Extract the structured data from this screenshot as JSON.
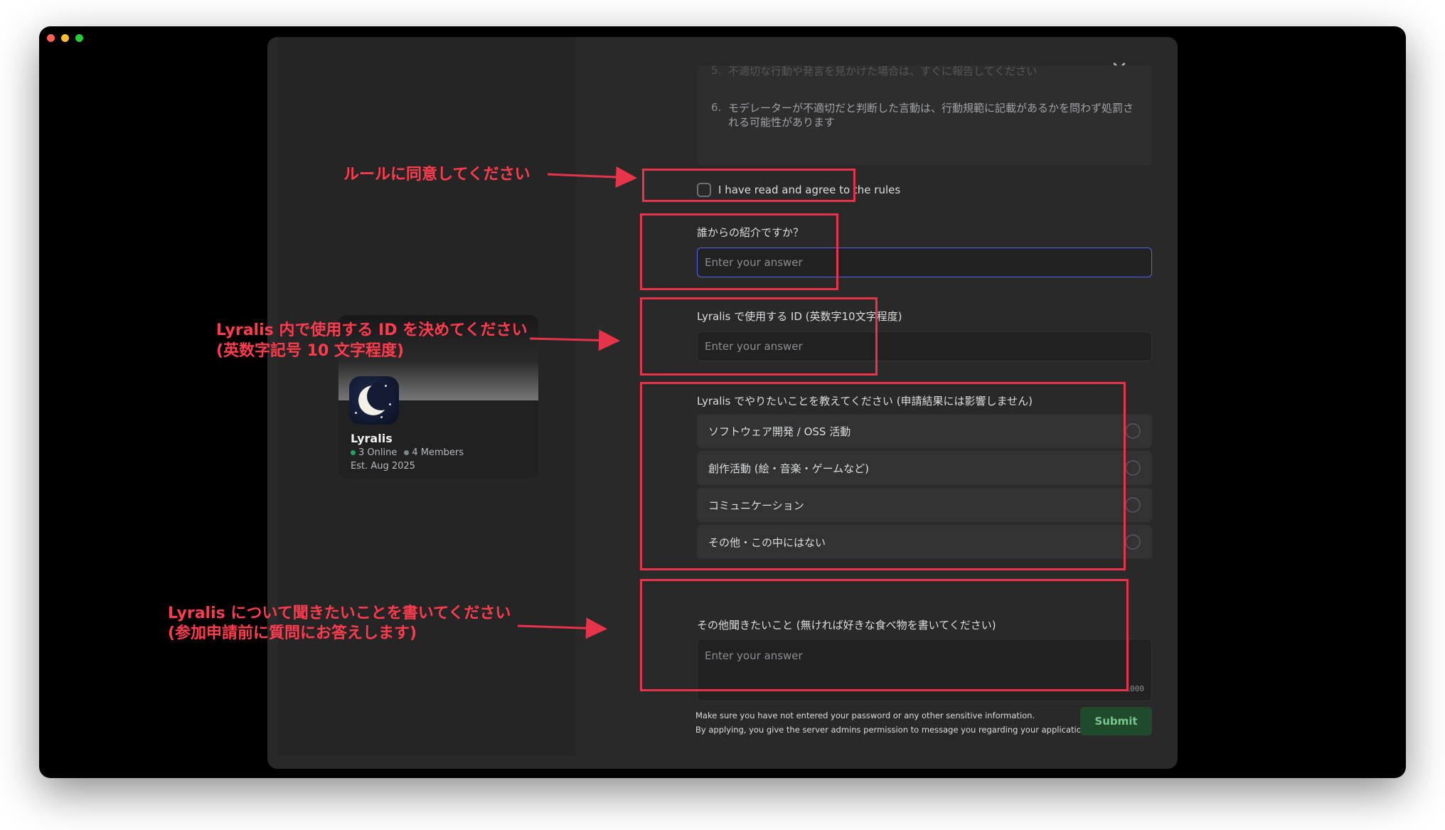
{
  "window": {
    "traffic_lights": [
      "close",
      "minimize",
      "maximize"
    ]
  },
  "server": {
    "name": "Lyralis",
    "online": "3 Online",
    "members": "4 Members",
    "established": "Est. Aug 2025"
  },
  "modal": {
    "close_icon": "×",
    "rules": [
      {
        "num": "5.",
        "text": "不適切な行動や発言を見かけた場合は、すぐに報告してください"
      },
      {
        "num": "6.",
        "text": "モデレーターが不適切だと判断した言動は、行動規範に記載があるかを問わず処罰される可能性があります"
      }
    ],
    "agree_label": "I have read and agree to the rules",
    "questions": {
      "referral": {
        "label": "誰からの紹介ですか？",
        "placeholder": "Enter your answer"
      },
      "lyralis_id": {
        "label": "Lyralis で使用する ID (英数字10文字程度)",
        "placeholder": "Enter your answer"
      },
      "goals": {
        "label": "Lyralis でやりたいことを教えてください (申請結果には影響しません)",
        "options": [
          "ソフトウェア開発 / OSS 活動",
          "創作活動 (絵・音楽・ゲームなど)",
          "コミュニケーション",
          "その他・この中にはない"
        ]
      },
      "other": {
        "label": "その他聞きたいこと (無ければ好きな食べ物を書いてください)",
        "placeholder": "Enter your answer",
        "counter": "1000"
      }
    },
    "footer_line1": "Make sure you have not entered your password or any other sensitive information.",
    "footer_line2": "By applying, you give the server admins permission to message you regarding your application.",
    "submit_label": "Submit"
  },
  "annotations": {
    "agree": "ルールに同意してください",
    "id_line1": "Lyralis 内で使用する ID を決めてください",
    "id_line2": "(英数字記号 10 文字程度)",
    "questions_line1": "Lyralis について聞きたいことを書いてください",
    "questions_line2": "(参加申請前に質問にお答えします)",
    "color": "#e8344a"
  }
}
